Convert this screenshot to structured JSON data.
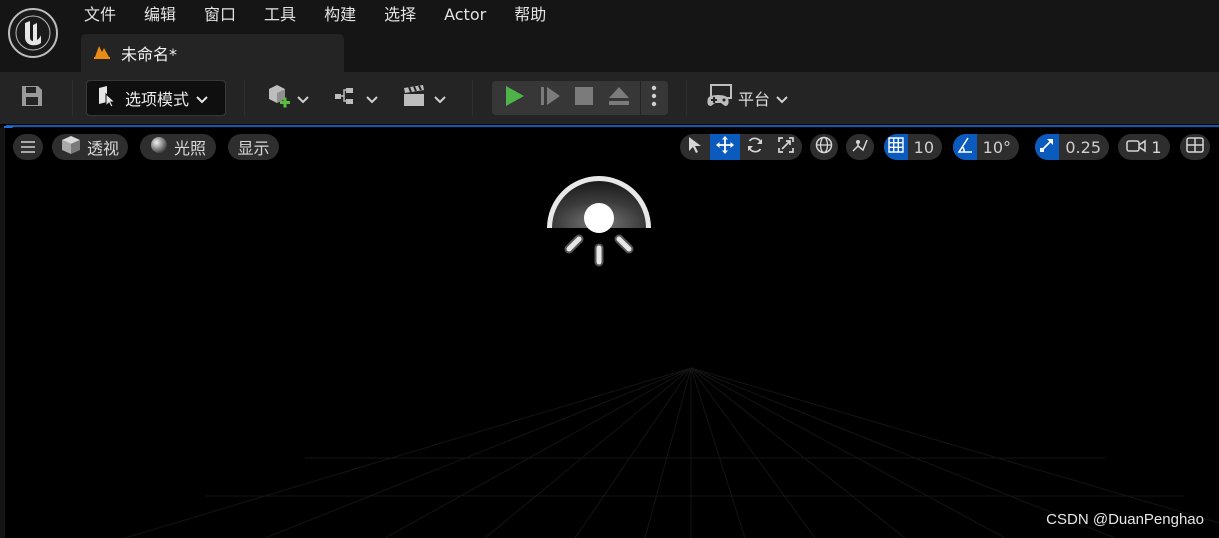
{
  "app": {
    "logo": "unreal-engine-logo"
  },
  "menu": {
    "items": [
      "文件",
      "编辑",
      "窗口",
      "工具",
      "构建",
      "选择",
      "Actor",
      "帮助"
    ]
  },
  "tab": {
    "label": "未命名*",
    "icon": "level-icon"
  },
  "toolbar": {
    "save_icon": "save-icon",
    "mode_label": "选项模式",
    "platform_label": "平台"
  },
  "viewport": {
    "perspective_label": "透视",
    "lighting_label": "光照",
    "show_label": "显示",
    "grid_snap_value": "10",
    "rotation_snap_value": "10°",
    "scale_snap_value": "0.25",
    "camera_speed_value": "1"
  },
  "watermark": "CSDN @DuanPenghao",
  "colors": {
    "accent": "#0b5bbf",
    "play_green": "#4fb34a",
    "background": "#000000"
  }
}
